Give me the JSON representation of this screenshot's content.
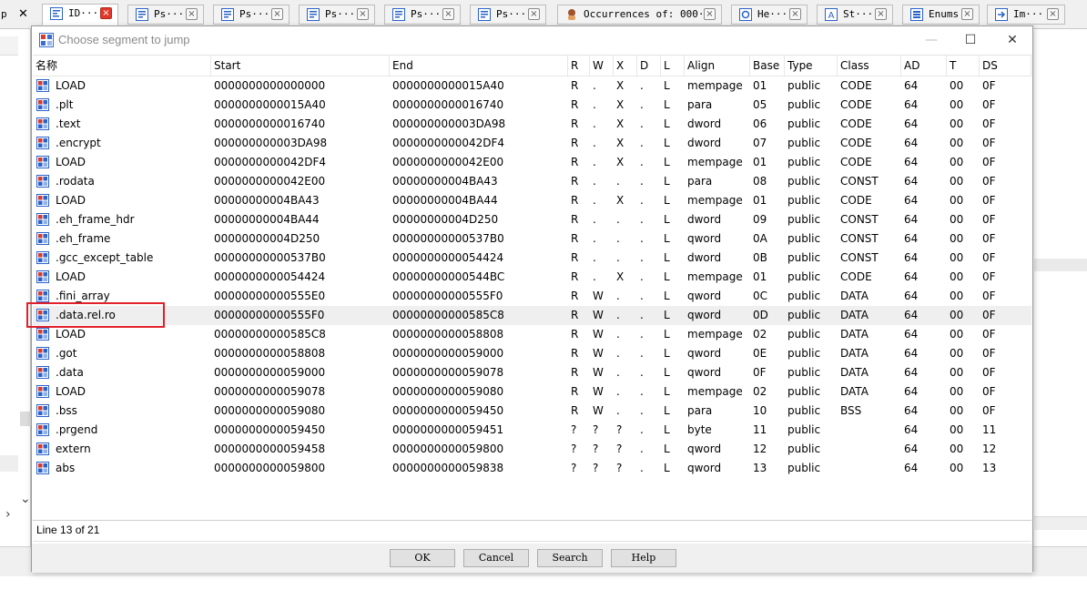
{
  "tabs": [
    {
      "label": "ID···",
      "icon": "disassembly-icon",
      "active": true
    },
    {
      "label": "Ps···",
      "icon": "pseudocode-icon"
    },
    {
      "label": "Ps···",
      "icon": "pseudocode-icon"
    },
    {
      "label": "Ps···",
      "icon": "pseudocode-icon"
    },
    {
      "label": "Ps···",
      "icon": "pseudocode-icon"
    },
    {
      "label": "Ps···",
      "icon": "pseudocode-icon"
    },
    {
      "label": "Occurrences of: 000···",
      "icon": "occurrences-icon"
    },
    {
      "label": "He···",
      "icon": "hex-view-icon"
    },
    {
      "label": "St···",
      "icon": "strings-icon"
    },
    {
      "label": "Enums",
      "icon": "enums-icon"
    },
    {
      "label": "Im···",
      "icon": "imports-icon"
    }
  ],
  "left_tab_fragment": "p",
  "left_close_glyph": "✕",
  "left_pane_arrows": {
    "down": "⌄",
    "right": "›"
  },
  "dialog": {
    "title": "Choose segment to jump",
    "controls": {
      "minimize": "—",
      "maximize": "☐",
      "close": "✕"
    },
    "columns": [
      "名称",
      "Start",
      "End",
      "R",
      "W",
      "X",
      "D",
      "L",
      "Align",
      "Base",
      "Type",
      "Class",
      "AD",
      "T",
      "DS"
    ],
    "rows": [
      {
        "name": "LOAD",
        "start": "0000000000000000",
        "end": "0000000000015A40",
        "r": "R",
        "w": ".",
        "x": "X",
        "d": ".",
        "l": "L",
        "align": "mempage",
        "base": "01",
        "type": "public",
        "class": "CODE",
        "ad": "64",
        "t": "00",
        "ds": "0F"
      },
      {
        "name": ".plt",
        "start": "0000000000015A40",
        "end": "0000000000016740",
        "r": "R",
        "w": ".",
        "x": "X",
        "d": ".",
        "l": "L",
        "align": "para",
        "base": "05",
        "type": "public",
        "class": "CODE",
        "ad": "64",
        "t": "00",
        "ds": "0F"
      },
      {
        "name": ".text",
        "start": "0000000000016740",
        "end": "000000000003DA98",
        "r": "R",
        "w": ".",
        "x": "X",
        "d": ".",
        "l": "L",
        "align": "dword",
        "base": "06",
        "type": "public",
        "class": "CODE",
        "ad": "64",
        "t": "00",
        "ds": "0F"
      },
      {
        "name": ".encrypt",
        "start": "000000000003DA98",
        "end": "0000000000042DF4",
        "r": "R",
        "w": ".",
        "x": "X",
        "d": ".",
        "l": "L",
        "align": "dword",
        "base": "07",
        "type": "public",
        "class": "CODE",
        "ad": "64",
        "t": "00",
        "ds": "0F"
      },
      {
        "name": "LOAD",
        "start": "0000000000042DF4",
        "end": "0000000000042E00",
        "r": "R",
        "w": ".",
        "x": "X",
        "d": ".",
        "l": "L",
        "align": "mempage",
        "base": "01",
        "type": "public",
        "class": "CODE",
        "ad": "64",
        "t": "00",
        "ds": "0F"
      },
      {
        "name": ".rodata",
        "start": "0000000000042E00",
        "end": "00000000004BA43",
        "r": "R",
        "w": ".",
        "x": ".",
        "d": ".",
        "l": "L",
        "align": "para",
        "base": "08",
        "type": "public",
        "class": "CONST",
        "ad": "64",
        "t": "00",
        "ds": "0F"
      },
      {
        "name": "LOAD",
        "start": "00000000004BA43",
        "end": "00000000004BA44",
        "r": "R",
        "w": ".",
        "x": "X",
        "d": ".",
        "l": "L",
        "align": "mempage",
        "base": "01",
        "type": "public",
        "class": "CODE",
        "ad": "64",
        "t": "00",
        "ds": "0F"
      },
      {
        "name": ".eh_frame_hdr",
        "start": "00000000004BA44",
        "end": "00000000004D250",
        "r": "R",
        "w": ".",
        "x": ".",
        "d": ".",
        "l": "L",
        "align": "dword",
        "base": "09",
        "type": "public",
        "class": "CONST",
        "ad": "64",
        "t": "00",
        "ds": "0F"
      },
      {
        "name": ".eh_frame",
        "start": "00000000004D250",
        "end": "00000000000537B0",
        "r": "R",
        "w": ".",
        "x": ".",
        "d": ".",
        "l": "L",
        "align": "qword",
        "base": "0A",
        "type": "public",
        "class": "CONST",
        "ad": "64",
        "t": "00",
        "ds": "0F"
      },
      {
        "name": ".gcc_except_table",
        "start": "00000000000537B0",
        "end": "0000000000054424",
        "r": "R",
        "w": ".",
        "x": ".",
        "d": ".",
        "l": "L",
        "align": "dword",
        "base": "0B",
        "type": "public",
        "class": "CONST",
        "ad": "64",
        "t": "00",
        "ds": "0F"
      },
      {
        "name": "LOAD",
        "start": "0000000000054424",
        "end": "00000000000544BC",
        "r": "R",
        "w": ".",
        "x": "X",
        "d": ".",
        "l": "L",
        "align": "mempage",
        "base": "01",
        "type": "public",
        "class": "CODE",
        "ad": "64",
        "t": "00",
        "ds": "0F"
      },
      {
        "name": ".fini_array",
        "start": "00000000000555E0",
        "end": "00000000000555F0",
        "r": "R",
        "w": "W",
        "x": ".",
        "d": ".",
        "l": "L",
        "align": "qword",
        "base": "0C",
        "type": "public",
        "class": "DATA",
        "ad": "64",
        "t": "00",
        "ds": "0F"
      },
      {
        "name": ".data.rel.ro",
        "start": "00000000000555F0",
        "end": "00000000000585C8",
        "r": "R",
        "w": "W",
        "x": ".",
        "d": ".",
        "l": "L",
        "align": "qword",
        "base": "0D",
        "type": "public",
        "class": "DATA",
        "ad": "64",
        "t": "00",
        "ds": "0F",
        "selected": true
      },
      {
        "name": "LOAD",
        "start": "00000000000585C8",
        "end": "0000000000058808",
        "r": "R",
        "w": "W",
        "x": ".",
        "d": ".",
        "l": "L",
        "align": "mempage",
        "base": "02",
        "type": "public",
        "class": "DATA",
        "ad": "64",
        "t": "00",
        "ds": "0F"
      },
      {
        "name": ".got",
        "start": "0000000000058808",
        "end": "0000000000059000",
        "r": "R",
        "w": "W",
        "x": ".",
        "d": ".",
        "l": "L",
        "align": "qword",
        "base": "0E",
        "type": "public",
        "class": "DATA",
        "ad": "64",
        "t": "00",
        "ds": "0F"
      },
      {
        "name": ".data",
        "start": "0000000000059000",
        "end": "0000000000059078",
        "r": "R",
        "w": "W",
        "x": ".",
        "d": ".",
        "l": "L",
        "align": "qword",
        "base": "0F",
        "type": "public",
        "class": "DATA",
        "ad": "64",
        "t": "00",
        "ds": "0F"
      },
      {
        "name": "LOAD",
        "start": "0000000000059078",
        "end": "0000000000059080",
        "r": "R",
        "w": "W",
        "x": ".",
        "d": ".",
        "l": "L",
        "align": "mempage",
        "base": "02",
        "type": "public",
        "class": "DATA",
        "ad": "64",
        "t": "00",
        "ds": "0F"
      },
      {
        "name": ".bss",
        "start": "0000000000059080",
        "end": "0000000000059450",
        "r": "R",
        "w": "W",
        "x": ".",
        "d": ".",
        "l": "L",
        "align": "para",
        "base": "10",
        "type": "public",
        "class": "BSS",
        "ad": "64",
        "t": "00",
        "ds": "0F"
      },
      {
        "name": ".prgend",
        "start": "0000000000059450",
        "end": "0000000000059451",
        "r": "?",
        "w": "?",
        "x": "?",
        "d": ".",
        "l": "L",
        "align": "byte",
        "base": "11",
        "type": "public",
        "class": "",
        "ad": "64",
        "t": "00",
        "ds": "11"
      },
      {
        "name": "extern",
        "start": "0000000000059458",
        "end": "0000000000059800",
        "r": "?",
        "w": "?",
        "x": "?",
        "d": ".",
        "l": "L",
        "align": "qword",
        "base": "12",
        "type": "public",
        "class": "",
        "ad": "64",
        "t": "00",
        "ds": "12"
      },
      {
        "name": "abs",
        "start": "0000000000059800",
        "end": "0000000000059838",
        "r": "?",
        "w": "?",
        "x": "?",
        "d": ".",
        "l": "L",
        "align": "qword",
        "base": "13",
        "type": "public",
        "class": "",
        "ad": "64",
        "t": "00",
        "ds": "13"
      }
    ],
    "status": "Line 13 of 21",
    "buttons": {
      "ok": "OK",
      "cancel": "Cancel",
      "search": "Search",
      "help": "Help"
    }
  },
  "colors": {
    "highlight": "#e0202a",
    "selected_row": "#efefef",
    "segment_icon": "#2a62c9"
  }
}
